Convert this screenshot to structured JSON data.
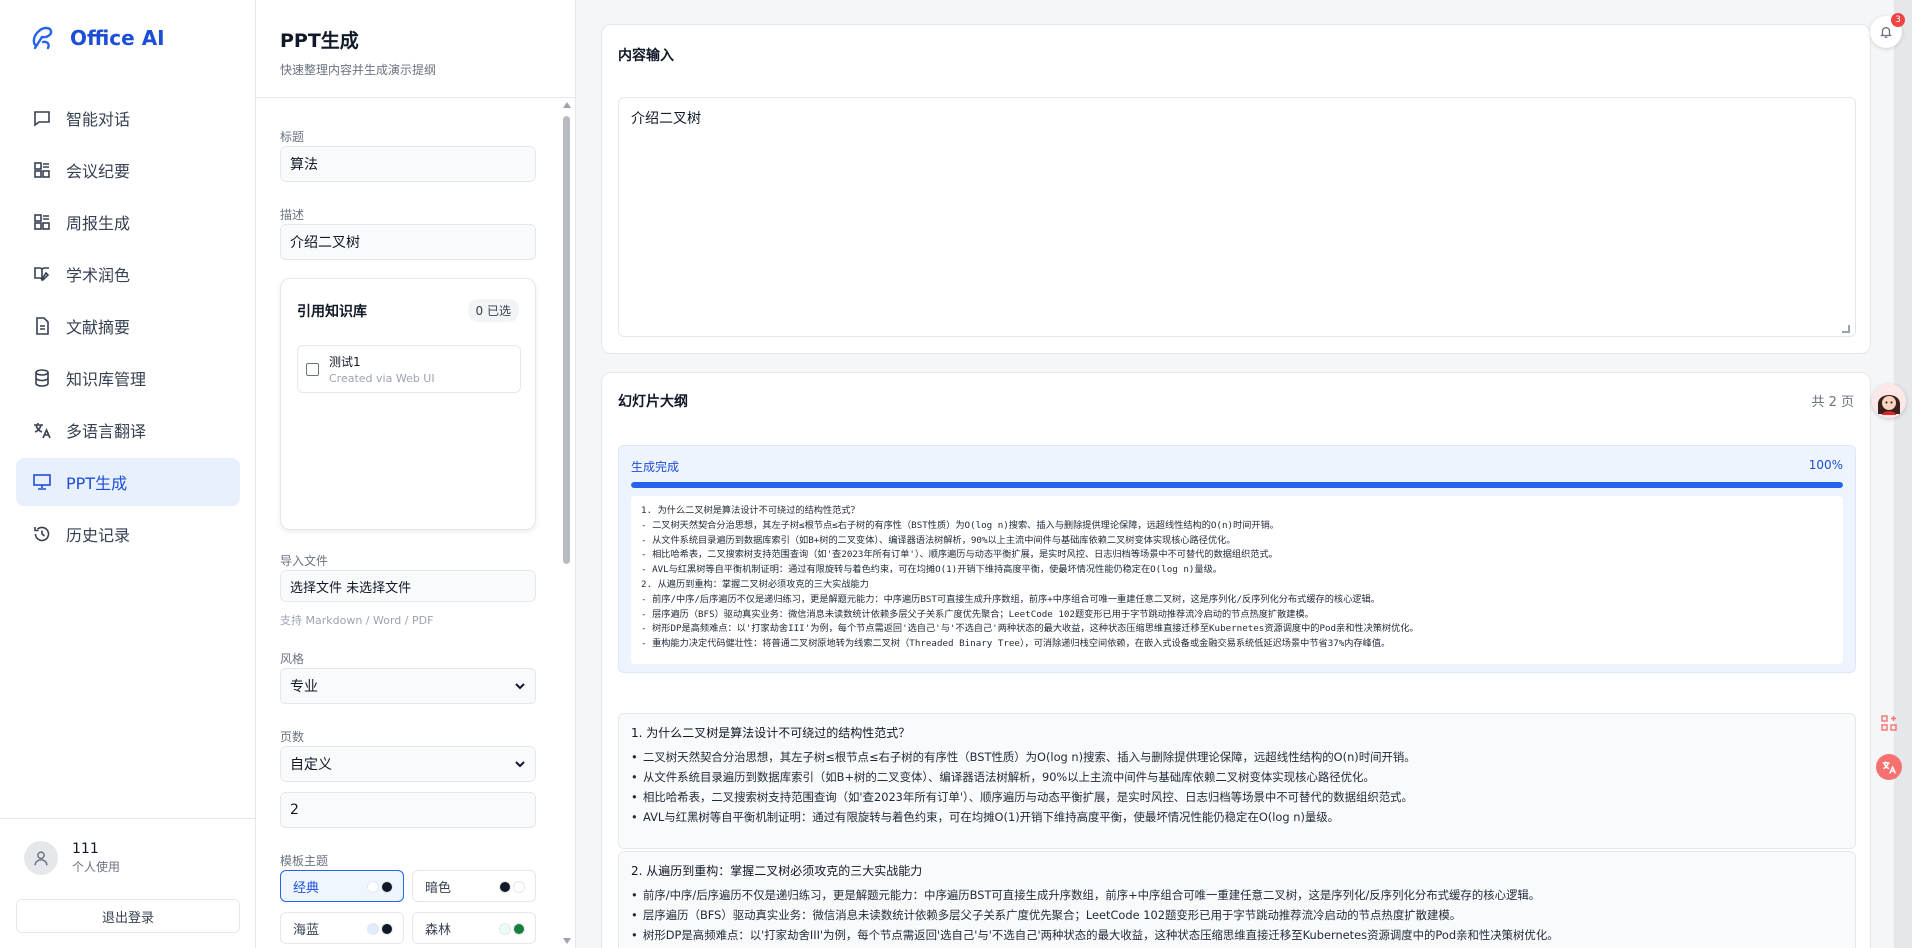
{
  "app": {
    "name": "Office AI"
  },
  "sidebar": {
    "items": [
      {
        "label": "智能对话",
        "icon": "chat-icon"
      },
      {
        "label": "会议纪要",
        "icon": "grid-icon"
      },
      {
        "label": "周报生成",
        "icon": "grid-icon"
      },
      {
        "label": "学术润色",
        "icon": "book-icon"
      },
      {
        "label": "文献摘要",
        "icon": "document-icon"
      },
      {
        "label": "知识库管理",
        "icon": "database-icon"
      },
      {
        "label": "多语言翻译",
        "icon": "translate-icon"
      },
      {
        "label": "PPT生成",
        "icon": "presentation-icon",
        "active": true
      },
      {
        "label": "历史记录",
        "icon": "history-icon"
      }
    ],
    "user": {
      "name": "111",
      "role": "个人使用"
    },
    "logout_label": "退出登录"
  },
  "panel": {
    "title": "PPT生成",
    "subtitle": "快速整理内容并生成演示提纲",
    "title_label": "标题",
    "title_value": "算法",
    "desc_label": "描述",
    "desc_value": "介绍二叉树",
    "kb": {
      "title": "引用知识库",
      "selected": "0 已选",
      "item_name": "测试1",
      "item_desc": "Created via Web UI"
    },
    "import_label": "导入文件",
    "file_button": "选择文件",
    "file_status": "未选择文件",
    "import_hint": "支持 Markdown / Word / PDF",
    "style_label": "风格",
    "style_value": "专业",
    "pages_label": "页数",
    "pages_mode": "自定义",
    "pages_value": "2",
    "theme_label": "模板主题",
    "themes": [
      {
        "label": "经典",
        "c1": "#ffffff",
        "c2": "#111827",
        "active": true
      },
      {
        "label": "暗色",
        "c1": "#111827",
        "c2": "#ffffff"
      },
      {
        "label": "海蓝",
        "c1": "#e0ecfb",
        "c2": "#111827"
      },
      {
        "label": "森林",
        "c1": "#ecfdf5",
        "c2": "#15803d"
      }
    ]
  },
  "content": {
    "title": "内容输入",
    "input": "介绍二叉树"
  },
  "outline": {
    "title": "幻灯片大纲",
    "page_count": "共 2 页",
    "status": "生成完成",
    "percent_label": "100%",
    "progress": 1.0,
    "raw_lines": [
      "1. 为什么二叉树是算法设计不可绕过的结构性范式？",
      "- 二叉树天然契合分治思想，其左子树≤根节点≤右子树的有序性（BST性质）为O(log n)搜索、插入与删除提供理论保障，远超线性结构的O(n)时间开销。",
      "- 从文件系统目录遍历到数据库索引（如B+树的二叉变体）、编译器语法树解析，90%以上主流中间件与基础库依赖二叉树变体实现核心路径优化。",
      "- 相比哈希表，二叉搜索树支持范围查询（如'查2023年所有订单'）、顺序遍历与动态平衡扩展，是实时风控、日志归档等场景中不可替代的数据组织范式。",
      "- AVL与红黑树等自平衡机制证明：通过有限旋转与着色约束，可在均摊O(1)开销下维持高度平衡，使最坏情况性能仍稳定在O(log n)量级。",
      "2. 从遍历到重构：掌握二叉树必须攻克的三大实战能力",
      "- 前序/中序/后序遍历不仅是递归练习，更是解题元能力：中序遍历BST可直接生成升序数组，前序+中序组合可唯一重建任意二叉树，这是序列化/反序列化分布式缓存的核心逻辑。",
      "- 层序遍历（BFS）驱动真实业务：微信消息未读数统计依赖多层父子关系广度优先聚合；LeetCode 102题变形已用于字节跳动推荐流冷启动的节点热度扩散建模。",
      "- 树形DP是高频难点：以'打家劫舍III'为例，每个节点需返回'选自己'与'不选自己'两种状态的最大收益，这种状态压缩思维直接迁移至Kubernetes资源调度中的Pod亲和性决策树优化。",
      "- 重构能力决定代码健壮性：将普通二叉树原地转为线索二叉树（Threaded Binary Tree），可消除递归栈空间依赖，在嵌入式设备或金融交易系统低延迟场景中节省37%内存峰值。"
    ],
    "sections": [
      {
        "title": "1. 为什么二叉树是算法设计不可绕过的结构性范式？",
        "bullets": [
          "二叉树天然契合分治思想，其左子树≤根节点≤右子树的有序性（BST性质）为O(log n)搜索、插入与删除提供理论保障，远超线性结构的O(n)时间开销。",
          "从文件系统目录遍历到数据库索引（如B+树的二叉变体）、编译器语法树解析，90%以上主流中间件与基础库依赖二叉树变体实现核心路径优化。",
          "相比哈希表，二叉搜索树支持范围查询（如'查2023年所有订单'）、顺序遍历与动态平衡扩展，是实时风控、日志归档等场景中不可替代的数据组织范式。",
          "AVL与红黑树等自平衡机制证明：通过有限旋转与着色约束，可在均摊O(1)开销下维持高度平衡，使最坏情况性能仍稳定在O(log n)量级。"
        ]
      },
      {
        "title": "2. 从遍历到重构：掌握二叉树必须攻克的三大实战能力",
        "bullets": [
          "前序/中序/后序遍历不仅是递归练习，更是解题元能力：中序遍历BST可直接生成升序数组，前序+中序组合可唯一重建任意二叉树，这是序列化/反序列化分布式缓存的核心逻辑。",
          "层序遍历（BFS）驱动真实业务：微信消息未读数统计依赖多层父子关系广度优先聚合；LeetCode 102题变形已用于字节跳动推荐流冷启动的节点热度扩散建模。",
          "树形DP是高频难点：以'打家劫舍III'为例，每个节点需返回'选自己'与'不选自己'两种状态的最大收益，这种状态压缩思维直接迁移至Kubernetes资源调度中的Pod亲和性决策树优化。"
        ]
      }
    ]
  },
  "notifications": {
    "count": "3"
  }
}
